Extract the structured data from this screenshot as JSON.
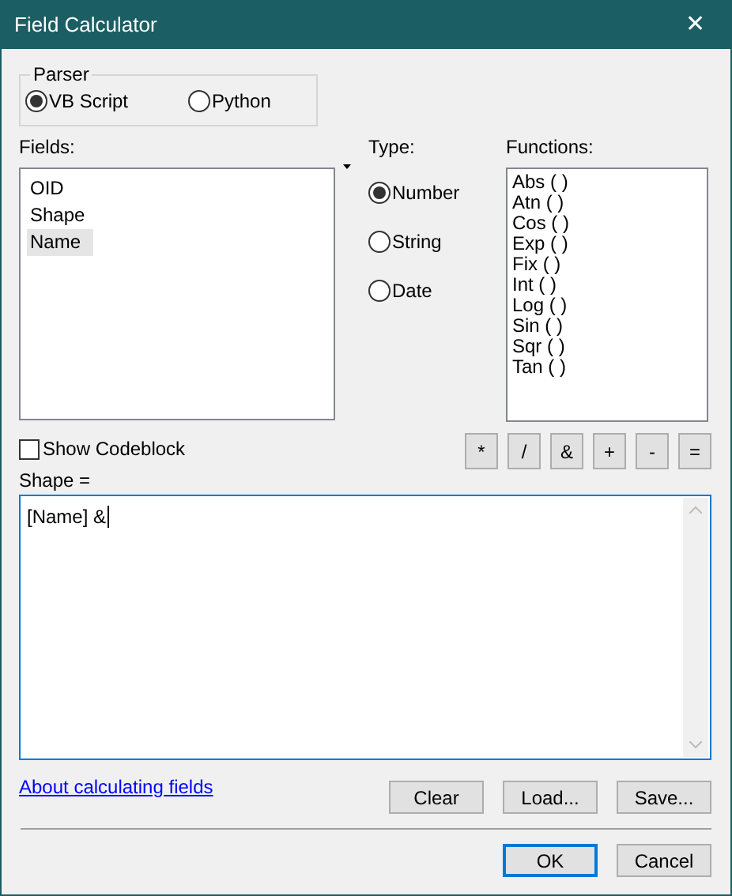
{
  "window": {
    "title": "Field Calculator",
    "close": "✕"
  },
  "parser": {
    "label": "Parser",
    "options": [
      {
        "label": "VB Script",
        "selected": true
      },
      {
        "label": "Python",
        "selected": false
      }
    ]
  },
  "fields": {
    "label": "Fields:",
    "items": [
      {
        "label": "OID",
        "selected": false
      },
      {
        "label": "Shape",
        "selected": false
      },
      {
        "label": "Name",
        "selected": true
      }
    ]
  },
  "type": {
    "label": "Type:",
    "options": [
      {
        "label": "Number",
        "selected": true
      },
      {
        "label": "String",
        "selected": false
      },
      {
        "label": "Date",
        "selected": false
      }
    ]
  },
  "functions": {
    "label": "Functions:",
    "items": [
      "Abs ( )",
      "Atn ( )",
      "Cos ( )",
      "Exp ( )",
      "Fix ( )",
      "Int ( )",
      "Log ( )",
      "Sin ( )",
      "Sqr ( )",
      "Tan ( )"
    ]
  },
  "show_codeblock": {
    "label": "Show Codeblock",
    "checked": false
  },
  "operators": [
    "*",
    "/",
    "&",
    "+",
    "-",
    "="
  ],
  "expression": {
    "label": "Shape =",
    "value": "[Name] &"
  },
  "help_link": "About calculating fields",
  "file_buttons": [
    "Clear",
    "Load...",
    "Save..."
  ],
  "dialog_buttons": [
    {
      "label": "OK",
      "default": true
    },
    {
      "label": "Cancel",
      "default": false
    }
  ]
}
